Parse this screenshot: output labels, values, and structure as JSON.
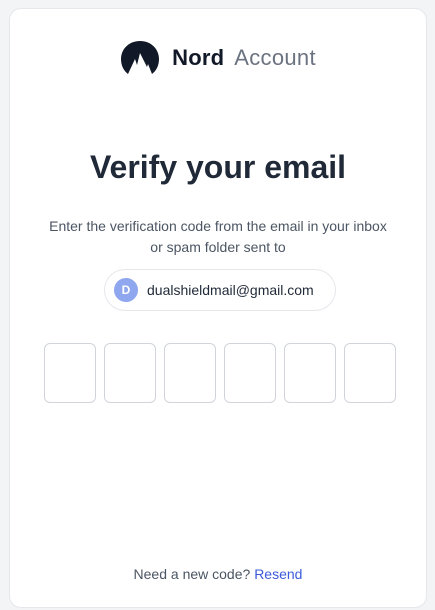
{
  "brand": {
    "name": "Nord",
    "product": "Account",
    "logo_icon": "nord-mountain-icon"
  },
  "page": {
    "title": "Verify your email",
    "subtitle_line1": "Enter the verification code from the email in your inbox",
    "subtitle_line2": "or spam folder sent to"
  },
  "email_chip": {
    "avatar_letter": "D",
    "email": "dualshieldmail@gmail.com",
    "avatar_color": "#8fa7ef"
  },
  "code_inputs": [
    "",
    "",
    "",
    "",
    "",
    ""
  ],
  "footer": {
    "prompt": "Need a new code?",
    "resend_label": "Resend",
    "link_color": "#3b5bdb"
  }
}
